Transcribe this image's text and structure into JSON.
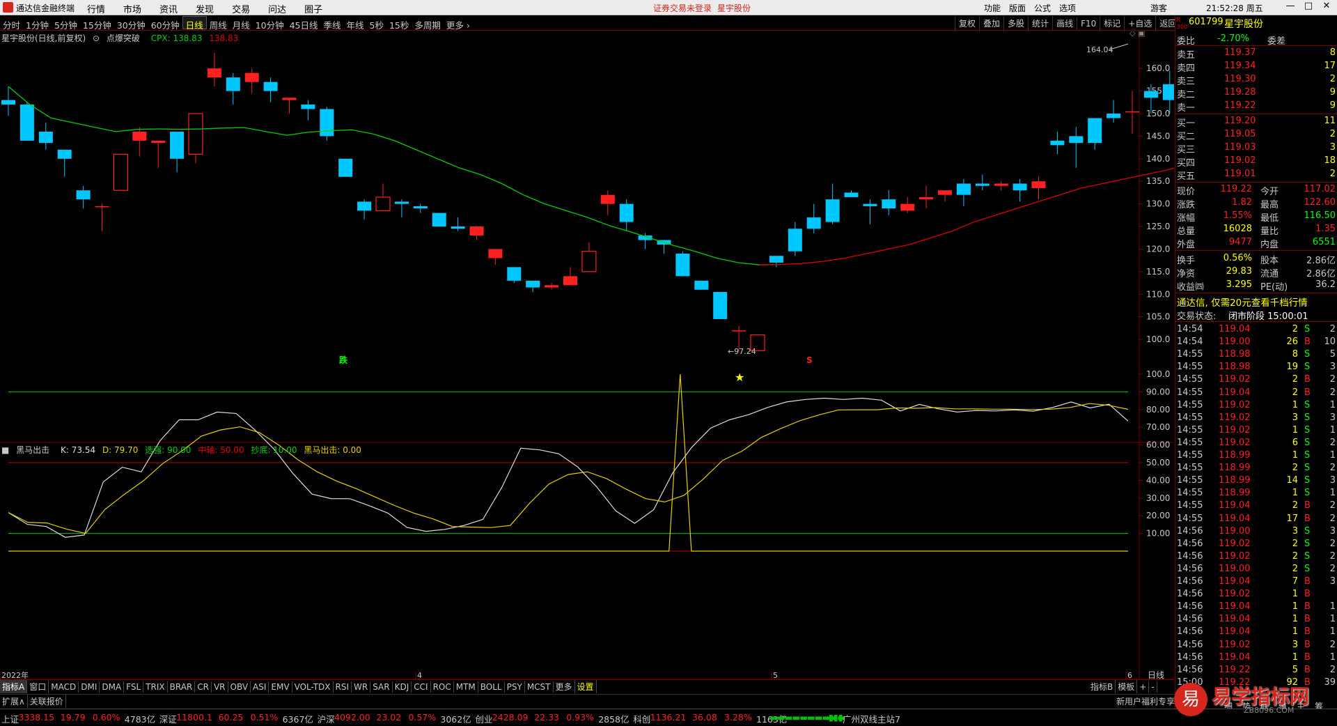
{
  "app": {
    "title": "通达信金融终端",
    "menu": [
      "行情",
      "市场",
      "资讯",
      "发现",
      "交易",
      "问达",
      "圈子"
    ],
    "alert": "证券交易未登录",
    "alert_stock": "星宇股份",
    "right_menu": [
      "功能",
      "版面",
      "公式",
      "选项"
    ],
    "guest": "游客",
    "time": "21:52:28 周五"
  },
  "periods": [
    "分时",
    "1分钟",
    "5分钟",
    "15分钟",
    "30分钟",
    "60分钟",
    "日线",
    "周线",
    "月线",
    "10分钟",
    "45日线",
    "季线",
    "年线",
    "5秒",
    "15秒",
    "多周期",
    "更多 ›"
  ],
  "active_period": "日线",
  "toolbar": [
    "复权",
    "叠加",
    "多股",
    "统计",
    "画线",
    "F10",
    "标记",
    "+自选",
    "返回"
  ],
  "main_info": {
    "title": "星宇股份(日线,前复权)",
    "indicator": "点爆突破",
    "cpx_label": "CPX: 138.83",
    "cpx_value": "138.83"
  },
  "annotations": {
    "high": "164.04",
    "low": "97.24",
    "die": "跌",
    "s": "S"
  },
  "sub_info": {
    "name": "黑马出击",
    "k": "K: 73.54",
    "d": "D: 79.70",
    "xuangu": "选强: 90.00",
    "zhongzhou": "中轴: 50.00",
    "chaodi": "抄底: 10.00",
    "heima": "黑马出击: 0.00"
  },
  "date_labels": [
    "2022年",
    "4",
    "5",
    "6"
  ],
  "period_label": "日线",
  "indicator_tabs": [
    "指标A",
    "窗口",
    "MACD",
    "DMI",
    "DMA",
    "FSL",
    "TRIX",
    "BRAR",
    "CR",
    "VR",
    "OBV",
    "ASI",
    "EMV",
    "VOL-TDX",
    "RSI",
    "WR",
    "SAR",
    "KDJ",
    "CCI",
    "ROC",
    "MTM",
    "BOLL",
    "PSY",
    "MCST",
    "更多",
    "设置"
  ],
  "right_tabs": [
    "指标B",
    "模板",
    "+",
    "-"
  ],
  "expand_tabs": [
    "扩展∧",
    "关联报价"
  ],
  "promo": "新用户福利专享",
  "stock": {
    "code": "601799",
    "name": "星宇股份",
    "badge_top": "R",
    "badge_bottom": "300"
  },
  "weibi": {
    "label": "委比",
    "value": "-2.70%",
    "label2": "委差"
  },
  "sell": [
    {
      "label": "卖五",
      "price": "119.37",
      "vol": "8"
    },
    {
      "label": "卖四",
      "price": "119.34",
      "vol": "17"
    },
    {
      "label": "卖三",
      "price": "119.30",
      "vol": "2"
    },
    {
      "label": "卖二",
      "price": "119.28",
      "vol": "9"
    },
    {
      "label": "卖一",
      "price": "119.22",
      "vol": "9"
    }
  ],
  "buy": [
    {
      "label": "买一",
      "price": "119.20",
      "vol": "11"
    },
    {
      "label": "买二",
      "price": "119.05",
      "vol": "2"
    },
    {
      "label": "买三",
      "price": "119.03",
      "vol": "3"
    },
    {
      "label": "买四",
      "price": "119.02",
      "vol": "18"
    },
    {
      "label": "买五",
      "price": "119.01",
      "vol": "2"
    }
  ],
  "quote": [
    {
      "l1": "现价",
      "v1": "119.22",
      "l2": "今开",
      "v2": "117.02"
    },
    {
      "l1": "涨跌",
      "v1": "1.82",
      "l2": "最高",
      "v2": "122.60"
    },
    {
      "l1": "涨幅",
      "v1": "1.55%",
      "l2": "最低",
      "v2": "116.50"
    },
    {
      "l1": "总量",
      "v1": "16028",
      "l2": "量比",
      "v2": "1.35"
    },
    {
      "l1": "外盘",
      "v1": "9477",
      "l2": "内盘",
      "v2": "6551"
    },
    {
      "l1": "换手",
      "v1": "0.56%",
      "l2": "股本",
      "v2": "2.86亿"
    },
    {
      "l1": "净资",
      "v1": "29.83",
      "l2": "流通",
      "v2": "2.86亿"
    },
    {
      "l1": "收益㈣",
      "v1": "3.295",
      "l2": "PE(动)",
      "v2": "36.2"
    }
  ],
  "ad_text": "通达信, 仅需20元查看千档行情",
  "trade_status": {
    "label": "交易状态:",
    "value": "闭市阶段 15:00:01"
  },
  "ticks": [
    [
      "14:54",
      "119.04",
      "2",
      "S",
      "2"
    ],
    [
      "14:54",
      "119.00",
      "26",
      "B",
      "10"
    ],
    [
      "14:55",
      "118.98",
      "8",
      "S",
      "5"
    ],
    [
      "14:55",
      "118.98",
      "19",
      "S",
      "3"
    ],
    [
      "14:55",
      "119.02",
      "2",
      "B",
      "2"
    ],
    [
      "14:55",
      "119.04",
      "2",
      "B",
      "2"
    ],
    [
      "14:55",
      "119.02",
      "1",
      "S",
      "1"
    ],
    [
      "14:55",
      "119.02",
      "3",
      "S",
      "3"
    ],
    [
      "14:55",
      "119.02",
      "1",
      "S",
      "1"
    ],
    [
      "14:55",
      "119.02",
      "6",
      "S",
      "2"
    ],
    [
      "14:55",
      "118.99",
      "1",
      "S",
      "1"
    ],
    [
      "14:55",
      "118.99",
      "2",
      "S",
      "2"
    ],
    [
      "14:55",
      "118.99",
      "14",
      "S",
      "3"
    ],
    [
      "14:55",
      "118.99",
      "1",
      "S",
      "1"
    ],
    [
      "14:55",
      "119.04",
      "2",
      "B",
      "2"
    ],
    [
      "14:55",
      "119.04",
      "17",
      "B",
      "2"
    ],
    [
      "14:56",
      "119.00",
      "3",
      "S",
      "3"
    ],
    [
      "14:56",
      "119.02",
      "2",
      "S",
      "2"
    ],
    [
      "14:56",
      "119.02",
      "2",
      "S",
      "2"
    ],
    [
      "14:56",
      "119.00",
      "2",
      "S",
      "2"
    ],
    [
      "14:56",
      "119.04",
      "7",
      "B",
      "3"
    ],
    [
      "14:56",
      "119.02",
      "1",
      "B",
      ""
    ],
    [
      "14:56",
      "119.04",
      "1",
      "B",
      "1"
    ],
    [
      "14:56",
      "119.04",
      "1",
      "B",
      "1"
    ],
    [
      "14:56",
      "119.04",
      "1",
      "B",
      "1"
    ],
    [
      "14:56",
      "119.02",
      "3",
      "B",
      "2"
    ],
    [
      "14:56",
      "119.04",
      "1",
      "B",
      "1"
    ],
    [
      "14:56",
      "119.22",
      "5",
      "B",
      "2"
    ],
    [
      "15:00",
      "119.22",
      "92",
      "B",
      "39"
    ]
  ],
  "right_bottom_tabs": [
    "细",
    "势",
    "联",
    "值",
    "主",
    "筹"
  ],
  "status": [
    {
      "name": "上证",
      "val": "3338.15",
      "chg": "19.79",
      "pct": "0.60%",
      "amt": "4783亿"
    },
    {
      "name": "深证",
      "val": "11800.1",
      "chg": "60.25",
      "pct": "0.51%",
      "amt": "6367亿"
    },
    {
      "name": "沪深",
      "val": "4092.00",
      "chg": "23.02",
      "pct": "0.57%",
      "amt": "3062亿"
    },
    {
      "name": "创业",
      "val": "2428.09",
      "chg": "22.33",
      "pct": "0.93%",
      "amt": "2858亿"
    },
    {
      "name": "科创",
      "val": "1136.21",
      "chg": "36.08",
      "pct": "3.28%",
      "amt": "1163亿"
    }
  ],
  "server": "广州双线主站7",
  "watermark": "易学指标网",
  "watermark_sub": "ZB8096.COM",
  "chart_data": [
    {
      "type": "candlestick",
      "y_axis_labels": [
        "160.0",
        "155.0",
        "150.0",
        "145.0",
        "140.0",
        "135.0",
        "130.0",
        "125.0",
        "120.0",
        "115.0",
        "110.0",
        "105.0",
        "100.0"
      ],
      "ylim": [
        97,
        164.5
      ],
      "candles": [
        [
          153,
          152,
          156,
          149.5
        ],
        [
          152,
          144,
          152.5,
          144
        ],
        [
          146,
          143.5,
          148,
          142
        ],
        [
          142,
          140,
          142,
          136
        ],
        [
          133,
          131,
          134,
          129
        ],
        [
          129.5,
          129.5,
          130,
          124
        ],
        [
          133,
          141,
          141,
          133
        ],
        [
          144,
          146,
          147,
          140.5
        ],
        [
          143.5,
          144,
          144,
          138
        ],
        [
          146,
          140,
          146,
          137
        ],
        [
          141,
          150,
          150,
          139
        ],
        [
          158,
          160,
          163.5,
          156
        ],
        [
          158,
          155,
          159,
          152
        ],
        [
          157,
          159,
          160,
          154.5
        ],
        [
          157,
          155,
          158,
          152.5
        ],
        [
          153,
          153.5,
          153.5,
          150
        ],
        [
          152,
          151,
          153,
          148.5
        ],
        [
          151,
          145,
          151.5,
          144
        ],
        [
          140,
          136,
          140,
          136
        ],
        [
          130.5,
          128.5,
          131,
          126.5
        ],
        [
          128.5,
          131.5,
          134.5,
          128.5
        ],
        [
          130.5,
          130,
          131,
          127
        ],
        [
          129.5,
          129,
          130,
          128
        ],
        [
          128,
          125,
          128,
          125
        ],
        [
          125,
          124.5,
          127,
          124
        ],
        [
          123,
          125,
          124.5,
          122
        ],
        [
          118,
          120,
          118,
          116.5
        ],
        [
          116,
          113,
          116,
          112.5
        ],
        [
          113,
          111.5,
          111.5,
          110.5
        ],
        [
          111.5,
          112,
          112.5,
          111
        ],
        [
          112,
          114,
          116,
          112
        ],
        [
          115,
          119.5,
          121.5,
          115
        ],
        [
          130,
          132,
          133,
          127.5
        ],
        [
          130,
          126,
          131,
          124
        ],
        [
          123,
          122,
          123.5,
          120
        ],
        [
          122,
          121,
          121.5,
          119
        ],
        [
          119,
          114,
          119.5,
          114
        ],
        [
          113,
          111,
          113,
          111
        ],
        [
          110.5,
          104.5,
          110.5,
          104.5
        ],
        [
          102,
          102,
          103,
          97.5
        ],
        [
          97.5,
          101,
          100.7,
          99.5
        ],
        [
          118.5,
          117,
          117,
          116
        ],
        [
          124.5,
          119.5,
          126,
          118.5
        ],
        [
          127,
          124.5,
          130,
          123.5
        ],
        [
          131,
          126,
          134.5,
          125.5
        ],
        [
          132.5,
          131.5,
          133,
          131.5
        ],
        [
          130,
          129.5,
          131,
          125.5
        ],
        [
          131,
          129,
          133,
          127.5
        ],
        [
          128.5,
          130,
          131.5,
          128
        ],
        [
          131,
          131.5,
          134,
          129
        ],
        [
          132,
          133,
          133,
          130.5
        ],
        [
          134.5,
          132,
          135.5,
          129.5
        ],
        [
          134.5,
          134,
          136.5,
          133
        ],
        [
          134,
          134.5,
          135,
          133
        ],
        [
          134.5,
          133,
          135.5,
          130.5
        ],
        [
          133.5,
          135,
          136,
          131
        ],
        [
          144,
          143,
          146,
          141
        ],
        [
          145,
          143.5,
          147,
          138
        ],
        [
          149,
          143.5,
          149,
          142
        ],
        [
          150,
          149,
          153,
          148
        ],
        [
          150.5,
          150.5,
          155,
          145.5
        ],
        [
          155,
          153.5,
          156.5,
          150
        ],
        [
          156.5,
          153,
          159.5,
          150
        ],
        [
          150,
          153,
          161,
          148.5
        ]
      ],
      "ma_line": [
        156,
        152,
        149,
        148,
        147,
        146,
        146.5,
        146.6,
        146.5,
        146.6,
        146.8,
        146.9,
        146,
        145.2,
        145.9,
        146.2,
        146.4,
        145.5,
        144,
        142,
        140,
        138,
        136.5,
        134.5,
        132,
        130,
        128.5,
        127,
        125.2,
        123.8,
        122.3,
        120.8,
        119.5,
        118,
        117,
        116.5,
        116.6,
        116.8,
        117.3,
        118,
        119,
        120,
        121,
        122.5,
        124,
        126,
        127.5,
        129,
        130.5,
        132,
        133.5,
        134.5,
        135.5,
        136.5,
        137.5,
        138.8
      ]
    },
    {
      "type": "line",
      "y_axis_labels": [
        "100.0",
        "90.00",
        "80.00",
        "70.00",
        "60.00",
        "50.00",
        "40.00",
        "30.00",
        "20.00",
        "10.00"
      ],
      "ylim": [
        0,
        100
      ],
      "hlines": [
        90,
        50,
        10
      ],
      "series": [
        {
          "values": [
            21.8,
            15.1,
            13.9,
            7.8,
            9.1,
            39.1,
            47.4,
            44.8,
            62.5,
            74.2,
            74.2,
            78.6,
            77.8,
            68.4,
            57.6,
            43.8,
            32.2,
            29.7,
            29.6,
            25.7,
            21.5,
            13.4,
            11.2,
            12.3,
            14.5,
            17.9,
            36,
            58.2,
            57.2,
            55,
            47.6,
            36.3,
            22.8,
            15.7,
            23.4,
            44.1,
            58.6,
            69.5,
            74.2,
            77.1,
            81.2,
            84.3,
            85.7,
            86.4,
            85.7,
            86.4,
            85.3,
            79.2,
            82.9,
            80.4,
            78.6,
            79.5,
            79.2,
            79.8,
            79.1,
            81.1,
            84.3,
            80.9,
            83,
            73.5
          ]
        },
        {
          "values": [
            21.8,
            16.3,
            15.9,
            12.5,
            10,
            23.5,
            32,
            39.8,
            49.5,
            56.7,
            65,
            68.5,
            70.2,
            67,
            60,
            51.6,
            44.8,
            39.6,
            35.4,
            30.6,
            25.8,
            21.5,
            18.2,
            13.9,
            13.6,
            13.3,
            14.5,
            27.1,
            37.9,
            43.3,
            44.8,
            40.9,
            35,
            29.7,
            27.8,
            31.5,
            40.8,
            51.3,
            56.5,
            64.2,
            69.2,
            73.7,
            77,
            79.8,
            79.9,
            79.9,
            80.9,
            80.7,
            81.1,
            80.4,
            80.4,
            80.2,
            80.2,
            80,
            80.2,
            81.2,
            83.4,
            82.4,
            80.1
          ]
        },
        {
          "values": [
            0,
            0,
            0,
            0,
            0,
            0,
            0,
            0,
            0,
            0,
            0,
            0,
            0,
            0,
            0,
            0,
            0,
            0,
            0,
            0,
            0,
            0,
            0,
            0,
            0,
            0,
            0,
            0,
            0,
            0,
            0,
            0,
            0,
            0,
            0,
            0,
            0,
            0,
            0,
            0,
            0,
            0,
            0,
            0,
            0,
            0,
            0,
            0,
            0,
            0,
            0,
            0,
            0,
            0,
            0,
            0,
            0,
            0,
            0,
            0,
            100,
            0,
            0,
            0,
            0,
            0,
            0,
            0,
            0,
            0,
            0,
            0,
            0,
            0,
            0,
            0,
            0,
            0,
            0,
            0,
            0,
            0,
            0,
            0,
            0,
            0,
            0,
            0,
            0,
            0,
            0,
            0,
            0,
            0,
            0,
            0,
            0,
            0,
            0,
            0,
            0
          ]
        }
      ]
    }
  ],
  "colors": {
    "up": "#ff2020",
    "down": "#00c8ff",
    "ma": "#00d000",
    "ma2": "#e00000",
    "grid": "#7a0000",
    "k": "#dddddd",
    "d": "#e6d000",
    "signal": "#e6d000",
    "hline_g": "#00d000",
    "hline_r": "#c00000"
  }
}
